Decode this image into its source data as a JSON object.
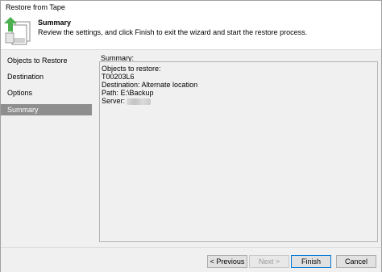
{
  "window": {
    "title": "Restore from Tape"
  },
  "header": {
    "icon": "tape-restore-wizard-icon",
    "heading": "Summary",
    "description": "Review the settings, and click Finish to exit the wizard and start the restore process."
  },
  "steps": [
    {
      "label": "Objects to Restore",
      "active": false
    },
    {
      "label": "Destination",
      "active": false
    },
    {
      "label": "Options",
      "active": false
    },
    {
      "label": "Summary",
      "active": true
    }
  ],
  "summary": {
    "label": "Summary:",
    "lines": [
      "Objects to restore:",
      "T00203L6",
      "Destination: Alternate location",
      "Path: E:\\Backup",
      "Server:"
    ]
  },
  "buttons": {
    "previous": "< Previous",
    "next": "Next >",
    "finish": "Finish",
    "cancel": "Cancel"
  },
  "colors": {
    "active_step": "#8e8e8e",
    "panel_bg": "#f0f0f0",
    "icon_green": "#4caf50"
  }
}
